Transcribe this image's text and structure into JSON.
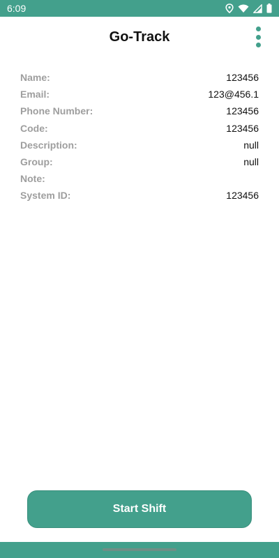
{
  "status_bar": {
    "time": "6:09",
    "icons": [
      "location-icon",
      "wifi-icon",
      "cell-signal-icon",
      "battery-icon"
    ]
  },
  "app_bar": {
    "title": "Go-Track",
    "menu_icon": "more-vert-icon"
  },
  "details": [
    {
      "label": "Name:",
      "value": "123456"
    },
    {
      "label": "Email:",
      "value": "123@456.1"
    },
    {
      "label": "Phone Number:",
      "value": "123456"
    },
    {
      "label": "Code:",
      "value": "123456"
    },
    {
      "label": "Description:",
      "value": "null"
    },
    {
      "label": "Group:",
      "value": "null"
    },
    {
      "label": "Note:",
      "value": ""
    },
    {
      "label": "System ID:",
      "value": "123456"
    }
  ],
  "actions": {
    "start_shift_label": "Start Shift"
  },
  "colors": {
    "accent": "#43a08c",
    "label_gray": "#9e9e9e",
    "text_dark": "#111111"
  }
}
